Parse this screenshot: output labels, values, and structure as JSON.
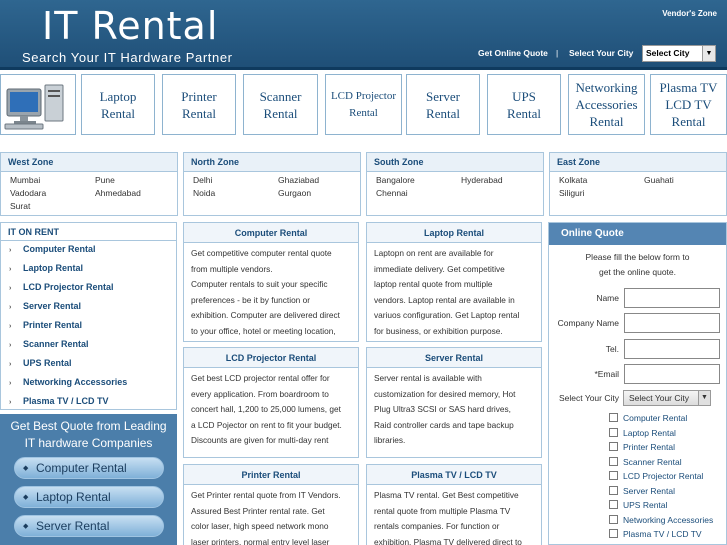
{
  "header": {
    "logo": "IT Rental",
    "tagline": "Search Your IT Hardware Partner",
    "vendors_zone": "Vendor's Zone",
    "get_online_quote": "Get Online Quote",
    "separator": "|",
    "select_city_label": "Select Your City",
    "city_select_value": "Select City"
  },
  "categories": [
    {
      "line1": "Laptop",
      "line2": "Rental"
    },
    {
      "line1": "Printer",
      "line2": "Rental"
    },
    {
      "line1": "Scanner",
      "line2": "Rental"
    },
    {
      "line1": "LCD Projector",
      "line2": "Rental"
    },
    {
      "line1": "Server",
      "line2": "Rental"
    },
    {
      "line1": "UPS",
      "line2": "Rental"
    },
    {
      "line1": "Networking",
      "line2": "Accessories",
      "line3": "Rental"
    },
    {
      "line1": "Plasma TV",
      "line2": "LCD TV",
      "line3": "Rental"
    }
  ],
  "zones": [
    {
      "title": "West Zone",
      "cities": [
        "Mumbai",
        "Pune",
        "Vadodara",
        "Ahmedabad",
        "Surat"
      ]
    },
    {
      "title": "North Zone",
      "cities": [
        "Delhi",
        "Ghaziabad",
        "Noida",
        "Gurgaon"
      ]
    },
    {
      "title": "South Zone",
      "cities": [
        "Bangalore",
        "Hyderabad",
        "Chennai"
      ]
    },
    {
      "title": "East Zone",
      "cities": [
        "Kolkata",
        "Guahati",
        "Siliguri"
      ]
    }
  ],
  "it_on_rent": {
    "title": "IT ON RENT",
    "items": [
      "Computer Rental",
      "Laptop Rental",
      "LCD Projector Rental",
      "Server Rental",
      "Printer Rental",
      "Scanner Rental",
      "UPS Rental",
      "Networking Accessories",
      "Plasma TV / LCD TV"
    ]
  },
  "best_quote": {
    "line1": "Get Best Quote from Leading",
    "line2": "IT hardware Companies",
    "buttons": [
      "Computer Rental",
      "Laptop Rental",
      "Server Rental"
    ]
  },
  "content": [
    {
      "title": "Computer Rental",
      "lines": [
        "Get competitive computer rental quote",
        "from multiple vendors.",
        "Computer rentals to suit your specific",
        "preferences - be it by function or",
        "exhibition. Computer are delivered direct",
        "to your office, hotel or meeting location,"
      ]
    },
    {
      "title": "Laptop Rental",
      "lines": [
        "Laptopn on rent are available for",
        "immediate delivery. Get competitive",
        "laptop rental quote from multiple",
        "vendors. Laptop rental are available in",
        "variuos configuration. Get Laptop rental",
        "for business, or exhibition purpose."
      ]
    },
    {
      "title": "LCD Projector Rental",
      "lines": [
        "Get best LCD projector rental offer for",
        "every application. From boardroom to",
        "concert hall, 1,200 to 25,000 lumens, get",
        "a LCD Pojector on rent to fit your budget.",
        "Discounts are given for multi-day rent"
      ]
    },
    {
      "title": "Server Rental",
      "lines": [
        "Server rental is available with",
        "customization for desired memory, Hot",
        "Plug Ultra3 SCSI or SAS hard drives,",
        "Raid controller cards and tape backup",
        "libraries."
      ]
    },
    {
      "title": "Printer Rental",
      "lines": [
        "Get Printer rental quote from IT Vendors.",
        "Assured Best Printer rental rate. Get",
        "color laser, high speed network mono",
        "laser printers, normal entry level laser"
      ]
    },
    {
      "title": "Plasma TV / LCD TV",
      "lines": [
        "Plasma TV rental. Get Best competitive",
        "rental quote from multiple Plasma TV",
        "rentals companies. For function or",
        "exhibition. Plasma TV delivered direct to"
      ]
    }
  ],
  "online_quote": {
    "title": "Online Quote",
    "intro1": "Please fill the below form to",
    "intro2": "get the online quote.",
    "fields": [
      "Name",
      "Company Name",
      "Tel.",
      "*Email"
    ],
    "city_label": "Select Your City",
    "city_value": "Select Your City",
    "checkboxes": [
      "Computer Rental",
      "Laptop Rental",
      "Printer Rental",
      "Scanner Rental",
      "LCD Projector Rental",
      "Server Rental",
      "UPS Rental",
      "Networking Accessories",
      "Plasma TV / LCD TV"
    ]
  }
}
